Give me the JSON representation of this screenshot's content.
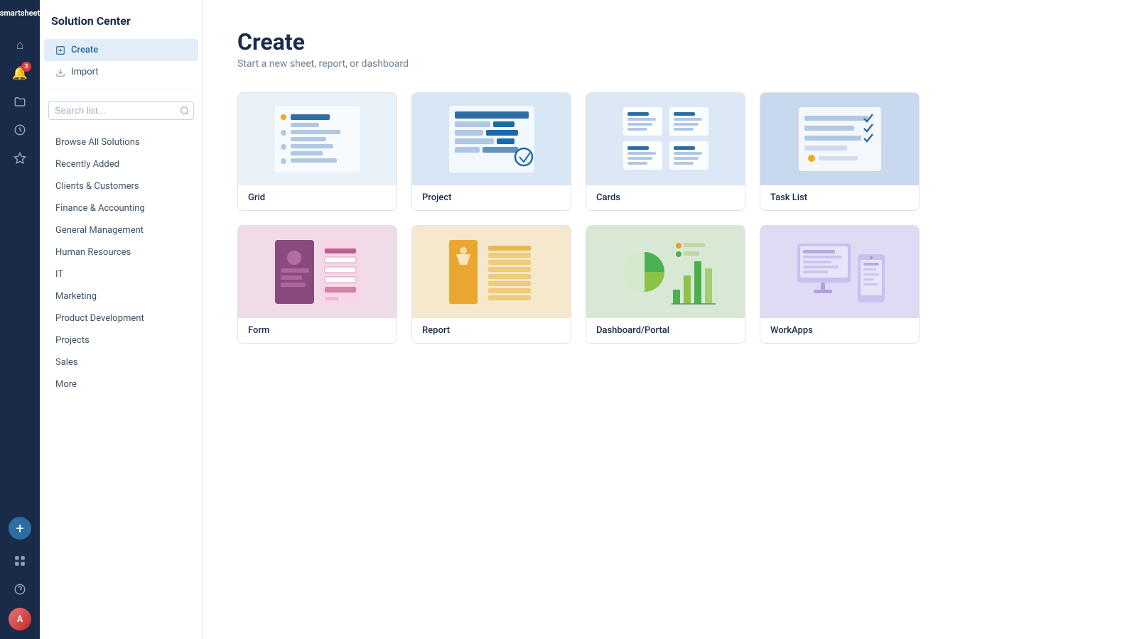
{
  "app": {
    "logo": "smartsheet"
  },
  "nav": {
    "icons": [
      {
        "name": "home-icon",
        "symbol": "⌂",
        "badge": null
      },
      {
        "name": "notifications-icon",
        "symbol": "🔔",
        "badge": "3"
      },
      {
        "name": "folder-icon",
        "symbol": "📁",
        "badge": null
      },
      {
        "name": "history-icon",
        "symbol": "🕐",
        "badge": null
      },
      {
        "name": "favorites-icon",
        "symbol": "★",
        "badge": null
      },
      {
        "name": "add-icon",
        "symbol": "+",
        "badge": null
      }
    ],
    "bottom_icons": [
      {
        "name": "apps-icon",
        "symbol": "⊞"
      },
      {
        "name": "help-icon",
        "symbol": "?"
      }
    ],
    "avatar_initials": "A"
  },
  "sidebar": {
    "title": "Solution Center",
    "create_label": "Create",
    "import_label": "Import",
    "search_placeholder": "Search list...",
    "items": [
      {
        "label": "Browse All Solutions",
        "name": "browse-all"
      },
      {
        "label": "Recently Added",
        "name": "recently-added"
      },
      {
        "label": "Clients & Customers",
        "name": "clients-customers"
      },
      {
        "label": "Finance & Accounting",
        "name": "finance-accounting"
      },
      {
        "label": "General Management",
        "name": "general-management"
      },
      {
        "label": "Human Resources",
        "name": "human-resources"
      },
      {
        "label": "IT",
        "name": "it"
      },
      {
        "label": "Marketing",
        "name": "marketing"
      },
      {
        "label": "Product Development",
        "name": "product-development"
      },
      {
        "label": "Projects",
        "name": "projects"
      },
      {
        "label": "Sales",
        "name": "sales"
      },
      {
        "label": "More",
        "name": "more"
      }
    ]
  },
  "main": {
    "title": "Create",
    "subtitle": "Start a new sheet, report, or dashboard",
    "cards": [
      {
        "label": "Grid",
        "theme": "grid"
      },
      {
        "label": "Project",
        "theme": "project"
      },
      {
        "label": "Cards",
        "theme": "cards"
      },
      {
        "label": "Task List",
        "theme": "tasklist"
      },
      {
        "label": "Form",
        "theme": "form"
      },
      {
        "label": "Report",
        "theme": "report"
      },
      {
        "label": "Dashboard/Portal",
        "theme": "dashboard"
      },
      {
        "label": "WorkApps",
        "theme": "workapps"
      }
    ]
  }
}
